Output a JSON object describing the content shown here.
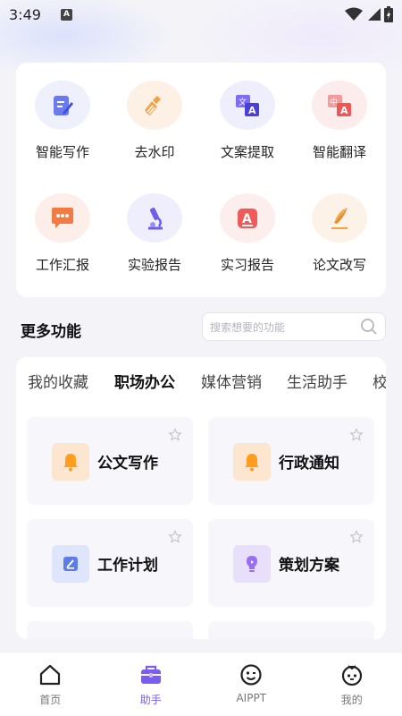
{
  "status": {
    "time": "3:49",
    "indicator": "A"
  },
  "tools": [
    {
      "label": "智能写作",
      "icon": "pen-note-icon"
    },
    {
      "label": "去水印",
      "icon": "broom-icon"
    },
    {
      "label": "文案提取",
      "icon": "translate-text-icon"
    },
    {
      "label": "智能翻译",
      "icon": "translate-icon"
    },
    {
      "label": "工作汇报",
      "icon": "chat-bubble-icon"
    },
    {
      "label": "实验报告",
      "icon": "microscope-icon"
    },
    {
      "label": "实习报告",
      "icon": "letter-a-icon"
    },
    {
      "label": "论文改写",
      "icon": "quill-icon"
    }
  ],
  "more": {
    "title": "更多功能",
    "search_placeholder": "搜索想要的功能"
  },
  "tabs": [
    {
      "label": "我的收藏",
      "active": false
    },
    {
      "label": "职场办公",
      "active": true
    },
    {
      "label": "媒体营销",
      "active": false
    },
    {
      "label": "生活助手",
      "active": false
    },
    {
      "label": "校",
      "active": false
    }
  ],
  "functions": [
    {
      "label": "公文写作",
      "icon": "bell-icon"
    },
    {
      "label": "行政通知",
      "icon": "bell-icon"
    },
    {
      "label": "工作计划",
      "icon": "plan-icon"
    },
    {
      "label": "策划方案",
      "icon": "lightbulb-icon"
    }
  ],
  "nav": [
    {
      "label": "首页",
      "icon": "home-icon",
      "active": false
    },
    {
      "label": "助手",
      "icon": "toolbox-icon",
      "active": true
    },
    {
      "label": "AIPPT",
      "icon": "smile-icon",
      "active": false
    },
    {
      "label": "我的",
      "icon": "profile-face-icon",
      "active": false
    }
  ],
  "colors": {
    "accent": "#7b5cf0",
    "bell": "#ff9d1c",
    "red": "#f25a5a"
  }
}
